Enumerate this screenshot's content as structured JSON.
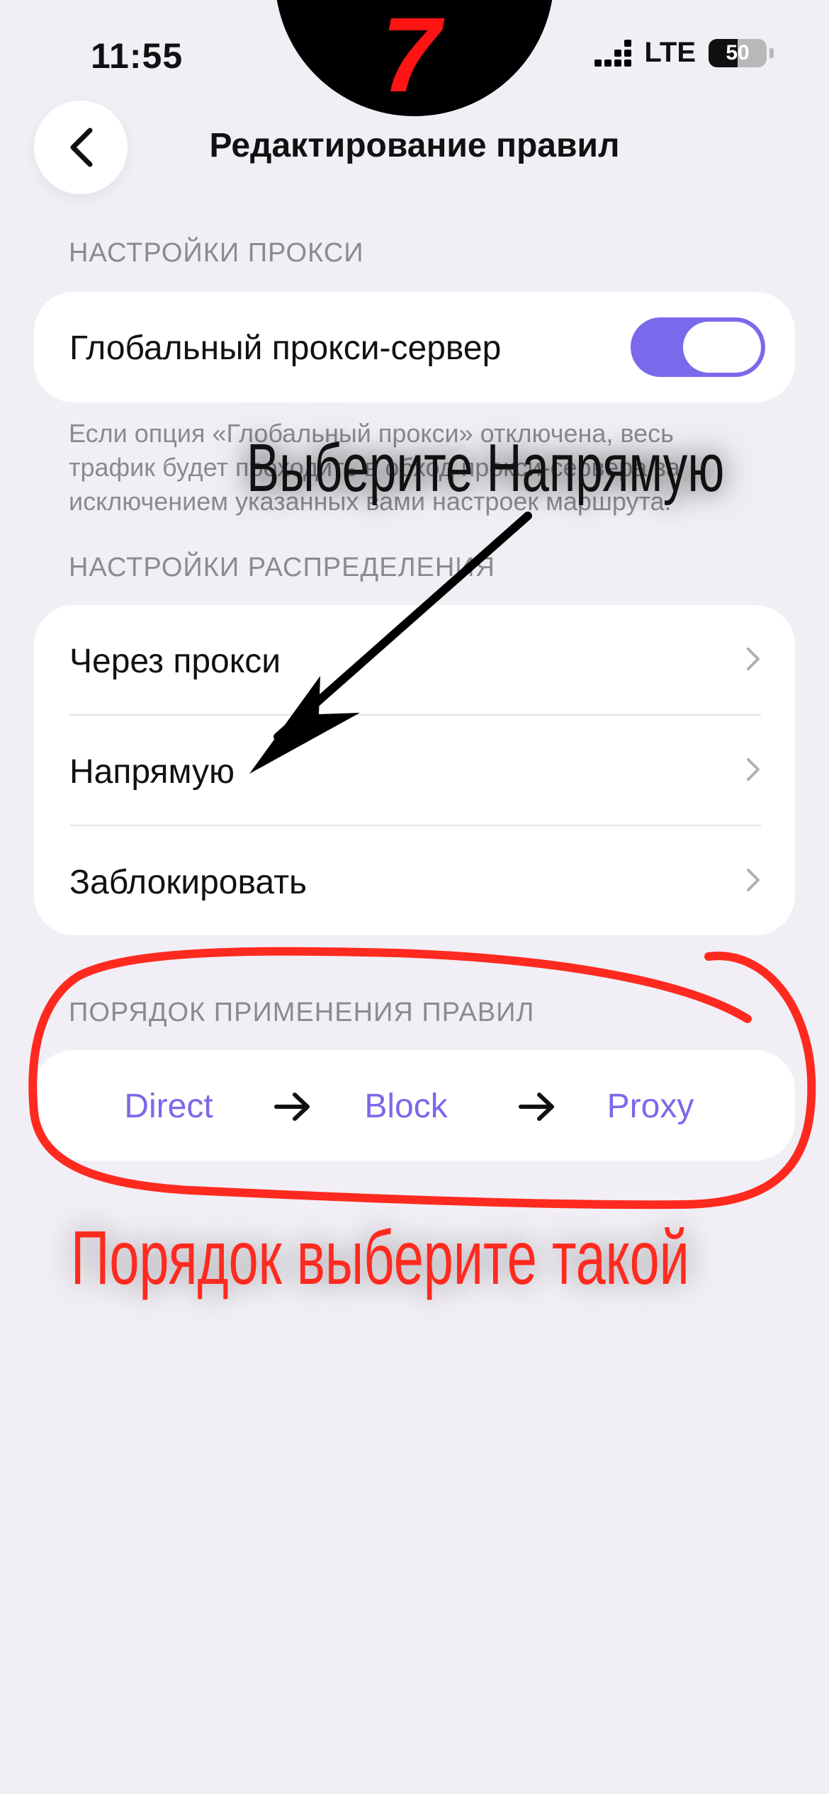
{
  "status_bar": {
    "time": "11:55",
    "network": "LTE",
    "battery": "50",
    "battery_level": 0.5
  },
  "annotation": {
    "step_number": "7",
    "callout": "Выберите Напрямую",
    "caption": "Порядок выберите такой",
    "callout_color": "#111111",
    "caption_color": "#ff2a1f"
  },
  "header": {
    "title": "Редактирование правил",
    "back_icon": "chevron-left-icon"
  },
  "proxy_settings": {
    "section_label": "НАСТРОЙКИ ПРОКСИ",
    "global_proxy_label": "Глобальный прокси-сервер",
    "global_proxy_enabled": true,
    "note": "Если опция «Глобальный прокси» отключена, весь трафик будет проходить в обход прокси-сервера за исключением указанных вами настроек маршрута."
  },
  "distribution_settings": {
    "section_label": "НАСТРОЙКИ РАСПРЕДЕЛЕНИЯ",
    "items": [
      {
        "label": "Через прокси"
      },
      {
        "label": "Напрямую"
      },
      {
        "label": "Заблокировать"
      }
    ]
  },
  "rule_order": {
    "section_label": "ПОРЯДОК ПРИМЕНЕНИЯ ПРАВИЛ",
    "items": [
      "Direct",
      "Block",
      "Proxy"
    ]
  },
  "colors": {
    "accent": "#7a69ea",
    "background": "#f1eff5",
    "annotation_red": "#ff2a1f"
  }
}
